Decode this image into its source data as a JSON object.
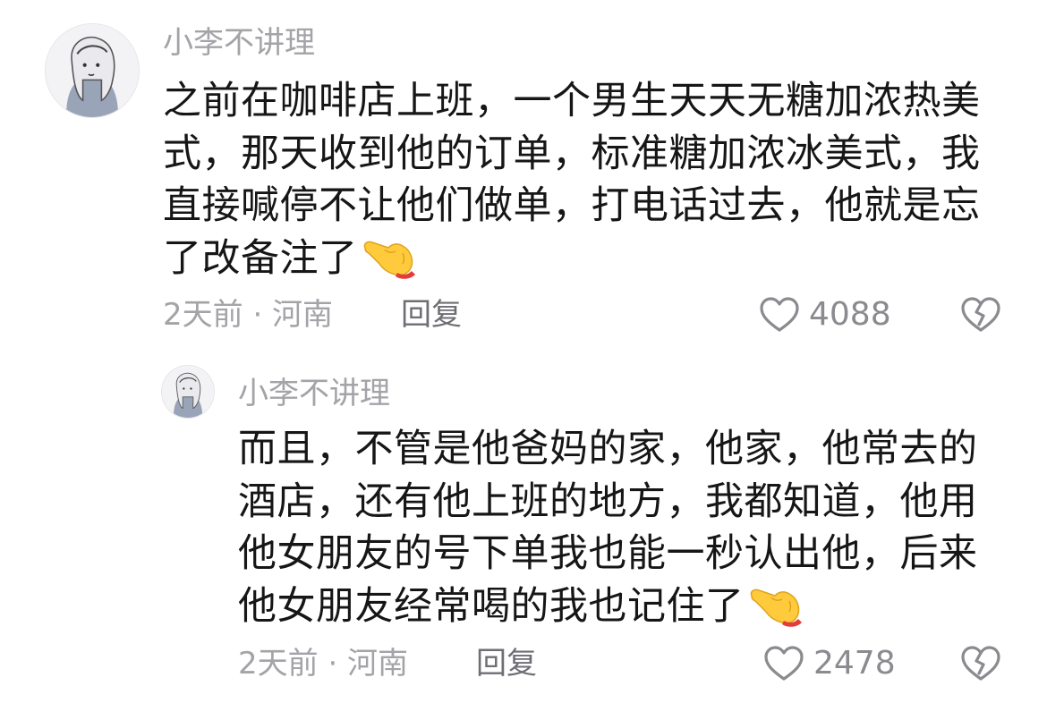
{
  "comments": [
    {
      "username": "小李不讲理",
      "text": "之前在咖啡店上班，一个男生天天无糖加浓热美式，那天收到他的订单，标准糖加浓冰美式，我直接喊停不让他们做单，打电话过去，他就是忘了改备注了",
      "time_location": "2天前 · 河南",
      "reply_label": "回复",
      "like_count": "4088",
      "emoji": "pointing-hand-emoji"
    },
    {
      "username": "小李不讲理",
      "text": "而且，不管是他爸妈的家，他家，他常去的酒店，还有他上班的地方，我都知道，他用他女朋友的号下单我也能一秒认出他，后来他女朋友经常喝的我也记住了",
      "time_location": "2天前 · 河南",
      "reply_label": "回复",
      "like_count": "2478",
      "emoji": "pointing-hand-emoji"
    }
  ],
  "colors": {
    "text": "#161616",
    "secondary": "#a3a3a8",
    "icon": "#8a8a8f"
  }
}
